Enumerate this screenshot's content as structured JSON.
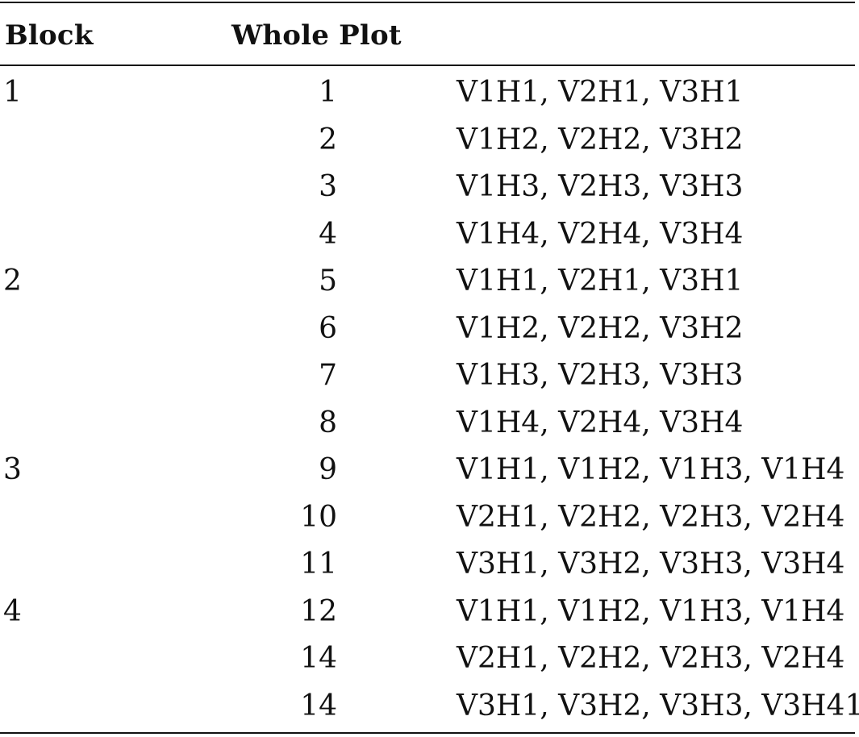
{
  "table": {
    "headers": {
      "block": "Block",
      "whole_plot": "Whole Plot",
      "treatments": ""
    },
    "rows": [
      {
        "block": "1",
        "whole_plot": "1",
        "treatments": "V1H1, V2H1, V3H1"
      },
      {
        "block": "",
        "whole_plot": "2",
        "treatments": "V1H2, V2H2, V3H2"
      },
      {
        "block": "",
        "whole_plot": "3",
        "treatments": "V1H3, V2H3, V3H3"
      },
      {
        "block": "",
        "whole_plot": "4",
        "treatments": "V1H4, V2H4, V3H4"
      },
      {
        "block": "2",
        "whole_plot": "5",
        "treatments": "V1H1, V2H1, V3H1"
      },
      {
        "block": "",
        "whole_plot": "6",
        "treatments": "V1H2, V2H2, V3H2"
      },
      {
        "block": "",
        "whole_plot": "7",
        "treatments": "V1H3, V2H3, V3H3"
      },
      {
        "block": "",
        "whole_plot": "8",
        "treatments": "V1H4, V2H4, V3H4"
      },
      {
        "block": "3",
        "whole_plot": "9",
        "treatments": "V1H1, V1H2, V1H3, V1H4"
      },
      {
        "block": "",
        "whole_plot": "10",
        "treatments": "V2H1, V2H2, V2H3, V2H4"
      },
      {
        "block": "",
        "whole_plot": "11",
        "treatments": "V3H1, V3H2, V3H3, V3H4"
      },
      {
        "block": "4",
        "whole_plot": "12",
        "treatments": "V1H1, V1H2, V1H3, V1H4"
      },
      {
        "block": "",
        "whole_plot": "14",
        "treatments": "V2H1, V2H2, V2H3, V2H4"
      },
      {
        "block": "",
        "whole_plot": "14",
        "treatments": "V3H1, V3H2, V3H3, V3H41"
      }
    ]
  }
}
